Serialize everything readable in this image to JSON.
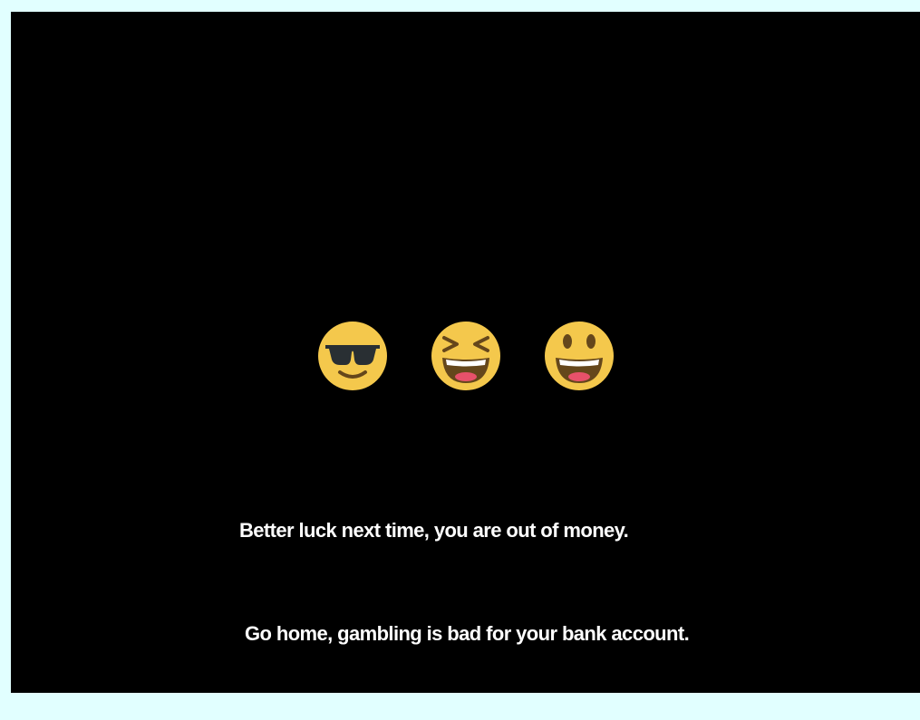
{
  "game": {
    "reels": [
      {
        "symbol": "smiling-face-with-sunglasses",
        "icon": "sunglasses-face-icon"
      },
      {
        "symbol": "grinning-squinting-face",
        "icon": "squinting-laugh-face-icon"
      },
      {
        "symbol": "grinning-face-with-big-eyes",
        "icon": "big-grin-face-icon"
      }
    ],
    "message_line_1": "Better luck next time, you are out of money.",
    "message_line_2": "Go home, gambling is bad for your bank account."
  },
  "colors": {
    "frame_background": "#e1ffff",
    "game_background": "#000000",
    "emoji_face": "#f4c84c",
    "emoji_features": "#65471b",
    "tongue": "#e7516a",
    "text": "#ffffff"
  }
}
